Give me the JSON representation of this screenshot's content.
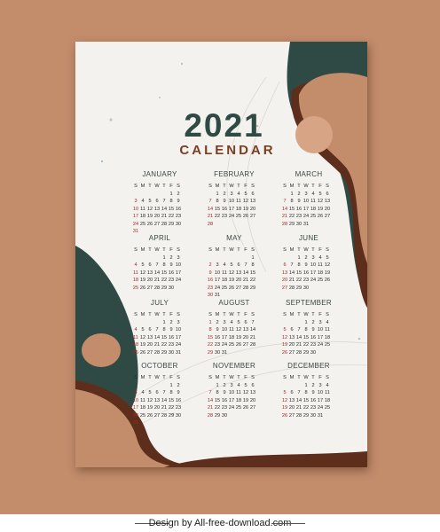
{
  "title": {
    "year": "2021",
    "subtitle": "CALENDAR"
  },
  "weekdays": [
    "S",
    "M",
    "T",
    "W",
    "T",
    "F",
    "S"
  ],
  "months": [
    {
      "name": "JANUARY",
      "offset": 5,
      "days": 31
    },
    {
      "name": "FEBRUARY",
      "offset": 1,
      "days": 28
    },
    {
      "name": "MARCH",
      "offset": 1,
      "days": 31
    },
    {
      "name": "APRIL",
      "offset": 4,
      "days": 30
    },
    {
      "name": "MAY",
      "offset": 6,
      "days": 31
    },
    {
      "name": "JUNE",
      "offset": 2,
      "days": 30
    },
    {
      "name": "JULY",
      "offset": 4,
      "days": 31
    },
    {
      "name": "AUGUST",
      "offset": 0,
      "days": 31
    },
    {
      "name": "SEPTEMBER",
      "offset": 3,
      "days": 30
    },
    {
      "name": "OCTOBER",
      "offset": 5,
      "days": 31
    },
    {
      "name": "NOVEMBER",
      "offset": 1,
      "days": 30
    },
    {
      "name": "DECEMBER",
      "offset": 3,
      "days": 31
    }
  ],
  "colors": {
    "teal": "#2f4a44",
    "brown": "#c38d6c",
    "dark_brown": "#5e2e1c",
    "paper": "#f4f2ef"
  },
  "footer": {
    "text": "Design by All-free-download.com"
  }
}
